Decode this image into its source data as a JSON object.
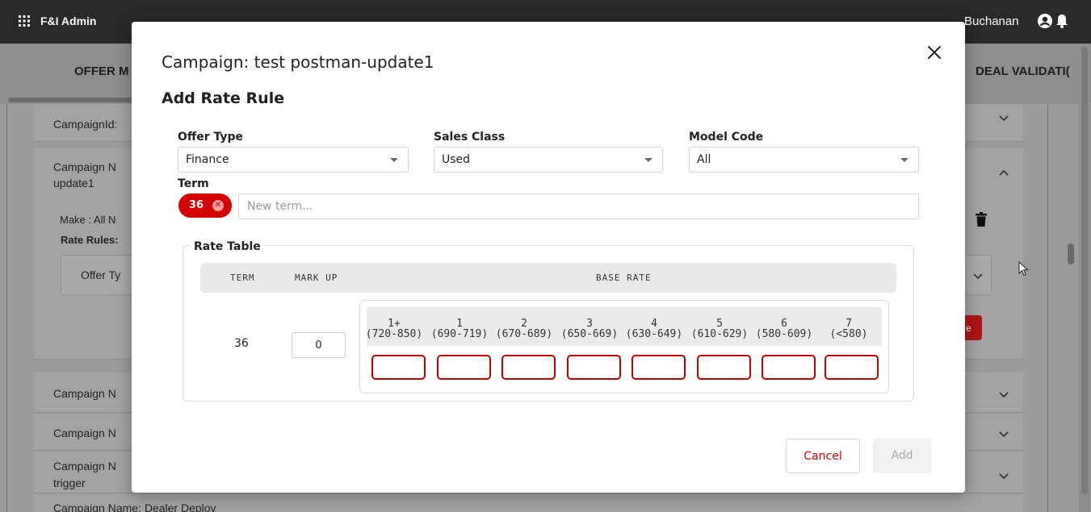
{
  "app": {
    "brand": "F&I Admin",
    "user_name": "Buchanan",
    "nav_left": "OFFER M",
    "nav_right": "DEAL VALIDATI("
  },
  "background": {
    "cards": [
      {
        "lines": [
          "CampaignId:"
        ]
      },
      {
        "lines": [
          "Campaign N",
          "update1"
        ]
      },
      {
        "lines": [
          "Make : All N"
        ]
      },
      {
        "lines": [
          "Rate Rules:"
        ]
      },
      {
        "lines": [
          "Offer Ty"
        ]
      },
      {
        "lines": [
          "Campaign N"
        ]
      },
      {
        "lines": [
          "Campaign N"
        ]
      },
      {
        "lines": [
          "Campaign N",
          "trigger"
        ]
      },
      {
        "lines": [
          "Campaign Name: Dealer Deploy"
        ]
      }
    ],
    "peek_button_label": "e"
  },
  "modal": {
    "title": "Campaign: test postman-update1",
    "subtitle": "Add Rate Rule",
    "offer_type": {
      "label": "Offer Type",
      "value": "Finance"
    },
    "sales_class": {
      "label": "Sales Class",
      "value": "Used"
    },
    "model_code": {
      "label": "Model Code",
      "value": "All"
    },
    "term": {
      "label": "Term",
      "chips": [
        "36"
      ],
      "placeholder": "New term..."
    },
    "rate_table": {
      "legend": "Rate Table",
      "headers": {
        "term": "TERM",
        "markup": "MARK UP",
        "base_rate": "BASE RATE"
      },
      "tiers": [
        {
          "tier": "1+",
          "range": "(720-850)"
        },
        {
          "tier": "1",
          "range": "(690-719)"
        },
        {
          "tier": "2",
          "range": "(670-689)"
        },
        {
          "tier": "3",
          "range": "(650-669)"
        },
        {
          "tier": "4",
          "range": "(630-649)"
        },
        {
          "tier": "5",
          "range": "(610-629)"
        },
        {
          "tier": "6",
          "range": "(580-609)"
        },
        {
          "tier": "7",
          "range": "(<580)"
        }
      ],
      "rows": [
        {
          "term": "36",
          "markup": "0",
          "rates": [
            "",
            "",
            "",
            "",
            "",
            "",
            "",
            ""
          ]
        }
      ]
    },
    "cancel_label": "Cancel",
    "add_label": "Add"
  },
  "colors": {
    "accent": "#d40000",
    "chip_bg": "#d40000",
    "disabled_bg": "#f1f1f1"
  },
  "icons": [
    "apps-grid-icon",
    "account-circle-icon",
    "bell-icon",
    "close-icon",
    "chip-remove-icon",
    "dropdown-caret-icon",
    "chevron-down-icon",
    "chevron-up-icon",
    "trash-icon",
    "mouse-cursor-icon"
  ]
}
